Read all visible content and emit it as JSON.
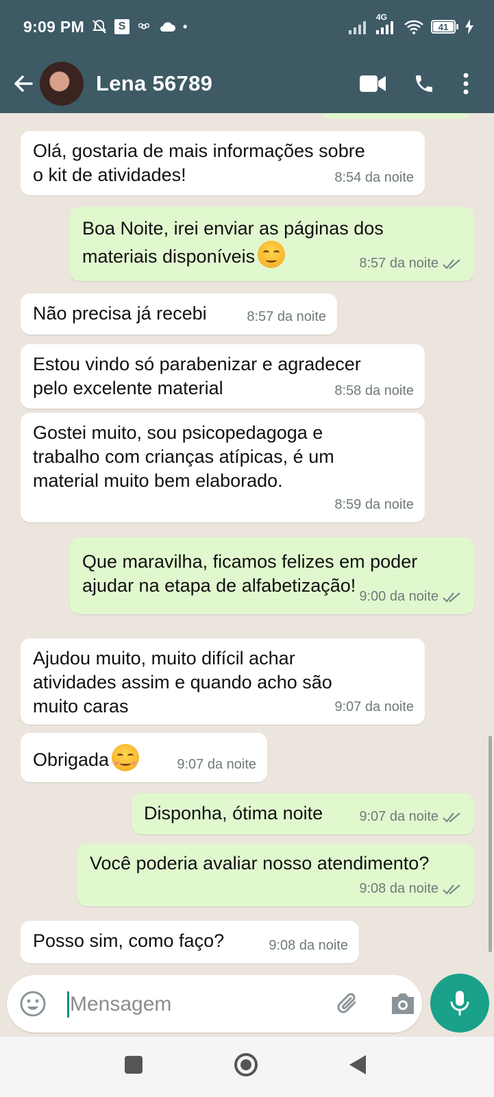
{
  "status_bar": {
    "time": "9:09 PM",
    "network_label": "4G",
    "battery_level": "41"
  },
  "header": {
    "contact_name": "Lena 56789",
    "icons": [
      "back-arrow-icon",
      "avatar",
      "video-call-icon",
      "phone-icon",
      "more-vert-icon"
    ]
  },
  "messages": [
    {
      "direction": "in",
      "text": "Olá, gostaria de mais informações sobre\no kit de atividades!",
      "time": "8:54 da noite"
    },
    {
      "direction": "out",
      "text": "Boa Noite, irei enviar as páginas dos\nmateriais disponíveis",
      "emoji": "smirking-face",
      "time": "8:57 da noite",
      "status": "read"
    },
    {
      "direction": "in",
      "text": "Não precisa já recebi",
      "time": "8:57 da noite"
    },
    {
      "direction": "in",
      "text": "Estou vindo só parabenizar e agradecer\npelo excelente material",
      "time": "8:58 da noite"
    },
    {
      "direction": "in",
      "text": "Gostei muito, sou psicopedagoga e\ntrabalho com crianças atípicas, é um\nmaterial muito bem elaborado.",
      "time": "8:59 da noite"
    },
    {
      "direction": "out",
      "text": "Que maravilha, ficamos felizes em poder\najudar na etapa de alfabetização!",
      "time": "9:00 da noite",
      "status": "read"
    },
    {
      "direction": "in",
      "text": "Ajudou muito, muito difícil achar\natividades assim e quando acho são\nmuito caras",
      "time": "9:07 da noite"
    },
    {
      "direction": "in",
      "text": "Obrigada",
      "emoji": "smiling-face",
      "time": "9:07 da noite"
    },
    {
      "direction": "out",
      "text": "Disponha, ótima noite",
      "time": "9:07 da noite",
      "status": "read"
    },
    {
      "direction": "out",
      "text": "Você poderia avaliar nosso atendimento?",
      "time": "9:08 da noite",
      "status": "read"
    },
    {
      "direction": "in",
      "text": "Posso sim, como faço?",
      "time": "9:08 da noite"
    }
  ],
  "composer": {
    "placeholder": "Mensagem",
    "icons": [
      "emoji-icon",
      "attach-icon",
      "camera-icon",
      "mic-icon"
    ]
  },
  "colors": {
    "header_bg": "#3d5a65",
    "chat_bg": "#ece5dd",
    "outgoing_bubble": "#e1f8cf",
    "incoming_bubble": "#ffffff",
    "accent": "#1aa18a",
    "read_ticks": "#7a8a8a"
  },
  "nav_bar": {
    "buttons": [
      "recent-apps-icon",
      "home-icon",
      "back-icon"
    ]
  }
}
